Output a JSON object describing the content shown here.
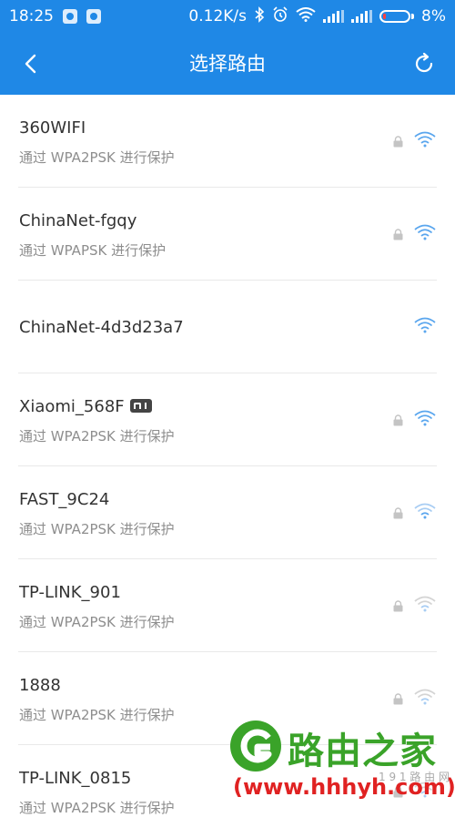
{
  "status_bar": {
    "time": "18:25",
    "net_speed": "0.12K/s",
    "battery": "8%"
  },
  "app_bar": {
    "title": "选择路由"
  },
  "networks": [
    {
      "ssid": "360WIFI",
      "security": "通过 WPA2PSK 进行保护",
      "locked": true,
      "signal": "strong"
    },
    {
      "ssid": "ChinaNet-fgqy",
      "security": "通过 WPAPSK 进行保护",
      "locked": true,
      "signal": "strong"
    },
    {
      "ssid": "ChinaNet-4d3d23a7",
      "security": "",
      "locked": false,
      "signal": "strong"
    },
    {
      "ssid": "Xiaomi_568F",
      "security": "通过 WPA2PSK 进行保护",
      "locked": true,
      "signal": "strong",
      "badge": "mi"
    },
    {
      "ssid": "FAST_9C24",
      "security": "通过 WPA2PSK 进行保护",
      "locked": true,
      "signal": "weak"
    },
    {
      "ssid": "TP-LINK_901",
      "security": "通过 WPA2PSK 进行保护",
      "locked": true,
      "signal": "weak"
    },
    {
      "ssid": "1888",
      "security": "通过 WPA2PSK 进行保护",
      "locked": true,
      "signal": "weak"
    },
    {
      "ssid": "TP-LINK_0815",
      "security": "通过 WPA2PSK 进行保护",
      "locked": true,
      "signal": "weak"
    }
  ],
  "watermark": {
    "title": "路由之家",
    "url": "(www.hhhyh.com)",
    "sub": "1 9 1 路 由 网"
  },
  "colors": {
    "accent": "#1f88e6",
    "wifi_strong": "#5aa6ee",
    "wifi_weak": "#a8cdf3",
    "lock": "#c4c4c4"
  }
}
